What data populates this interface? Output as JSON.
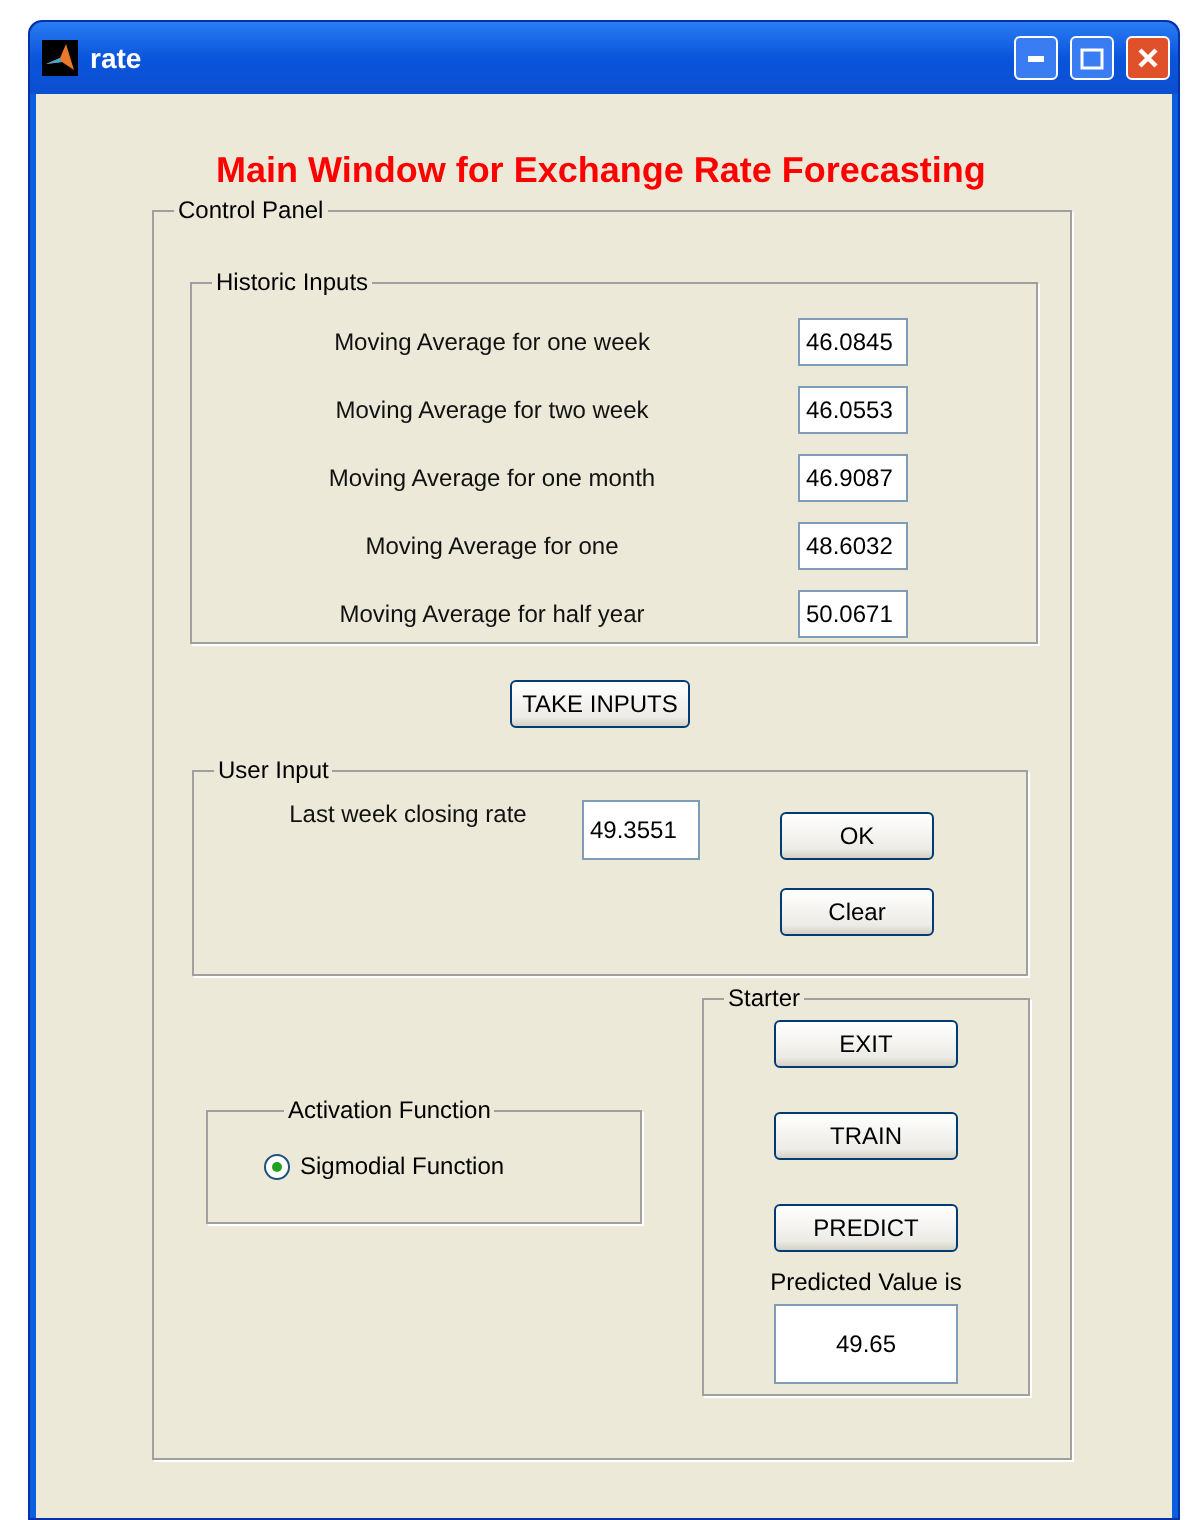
{
  "window": {
    "title": "rate"
  },
  "heading": "Main Window for Exchange Rate Forecasting",
  "control_panel": {
    "title": "Control Panel",
    "historic_inputs": {
      "title": "Historic Inputs",
      "rows": [
        {
          "label": "Moving Average for one week",
          "value": "46.0845"
        },
        {
          "label": "Moving Average for two week",
          "value": "46.0553"
        },
        {
          "label": "Moving Average for one month",
          "value": "46.9087"
        },
        {
          "label": "Moving Average for one",
          "value": "48.6032"
        },
        {
          "label": "Moving Average for half year",
          "value": "50.0671"
        }
      ]
    },
    "take_inputs_button": "TAKE INPUTS",
    "user_input": {
      "title": "User Input",
      "label": "Last week closing rate",
      "value": "49.3551",
      "buttons": [
        "OK",
        "Clear"
      ]
    },
    "activation_function": {
      "title": "Activation Function",
      "options": [
        {
          "label": "Sigmodial Function",
          "selected": true
        }
      ]
    },
    "starter": {
      "title": "Starter",
      "buttons": [
        "EXIT",
        "TRAIN",
        "PREDICT"
      ],
      "result_label": "Predicted Value is",
      "result_value": "49.65"
    }
  }
}
